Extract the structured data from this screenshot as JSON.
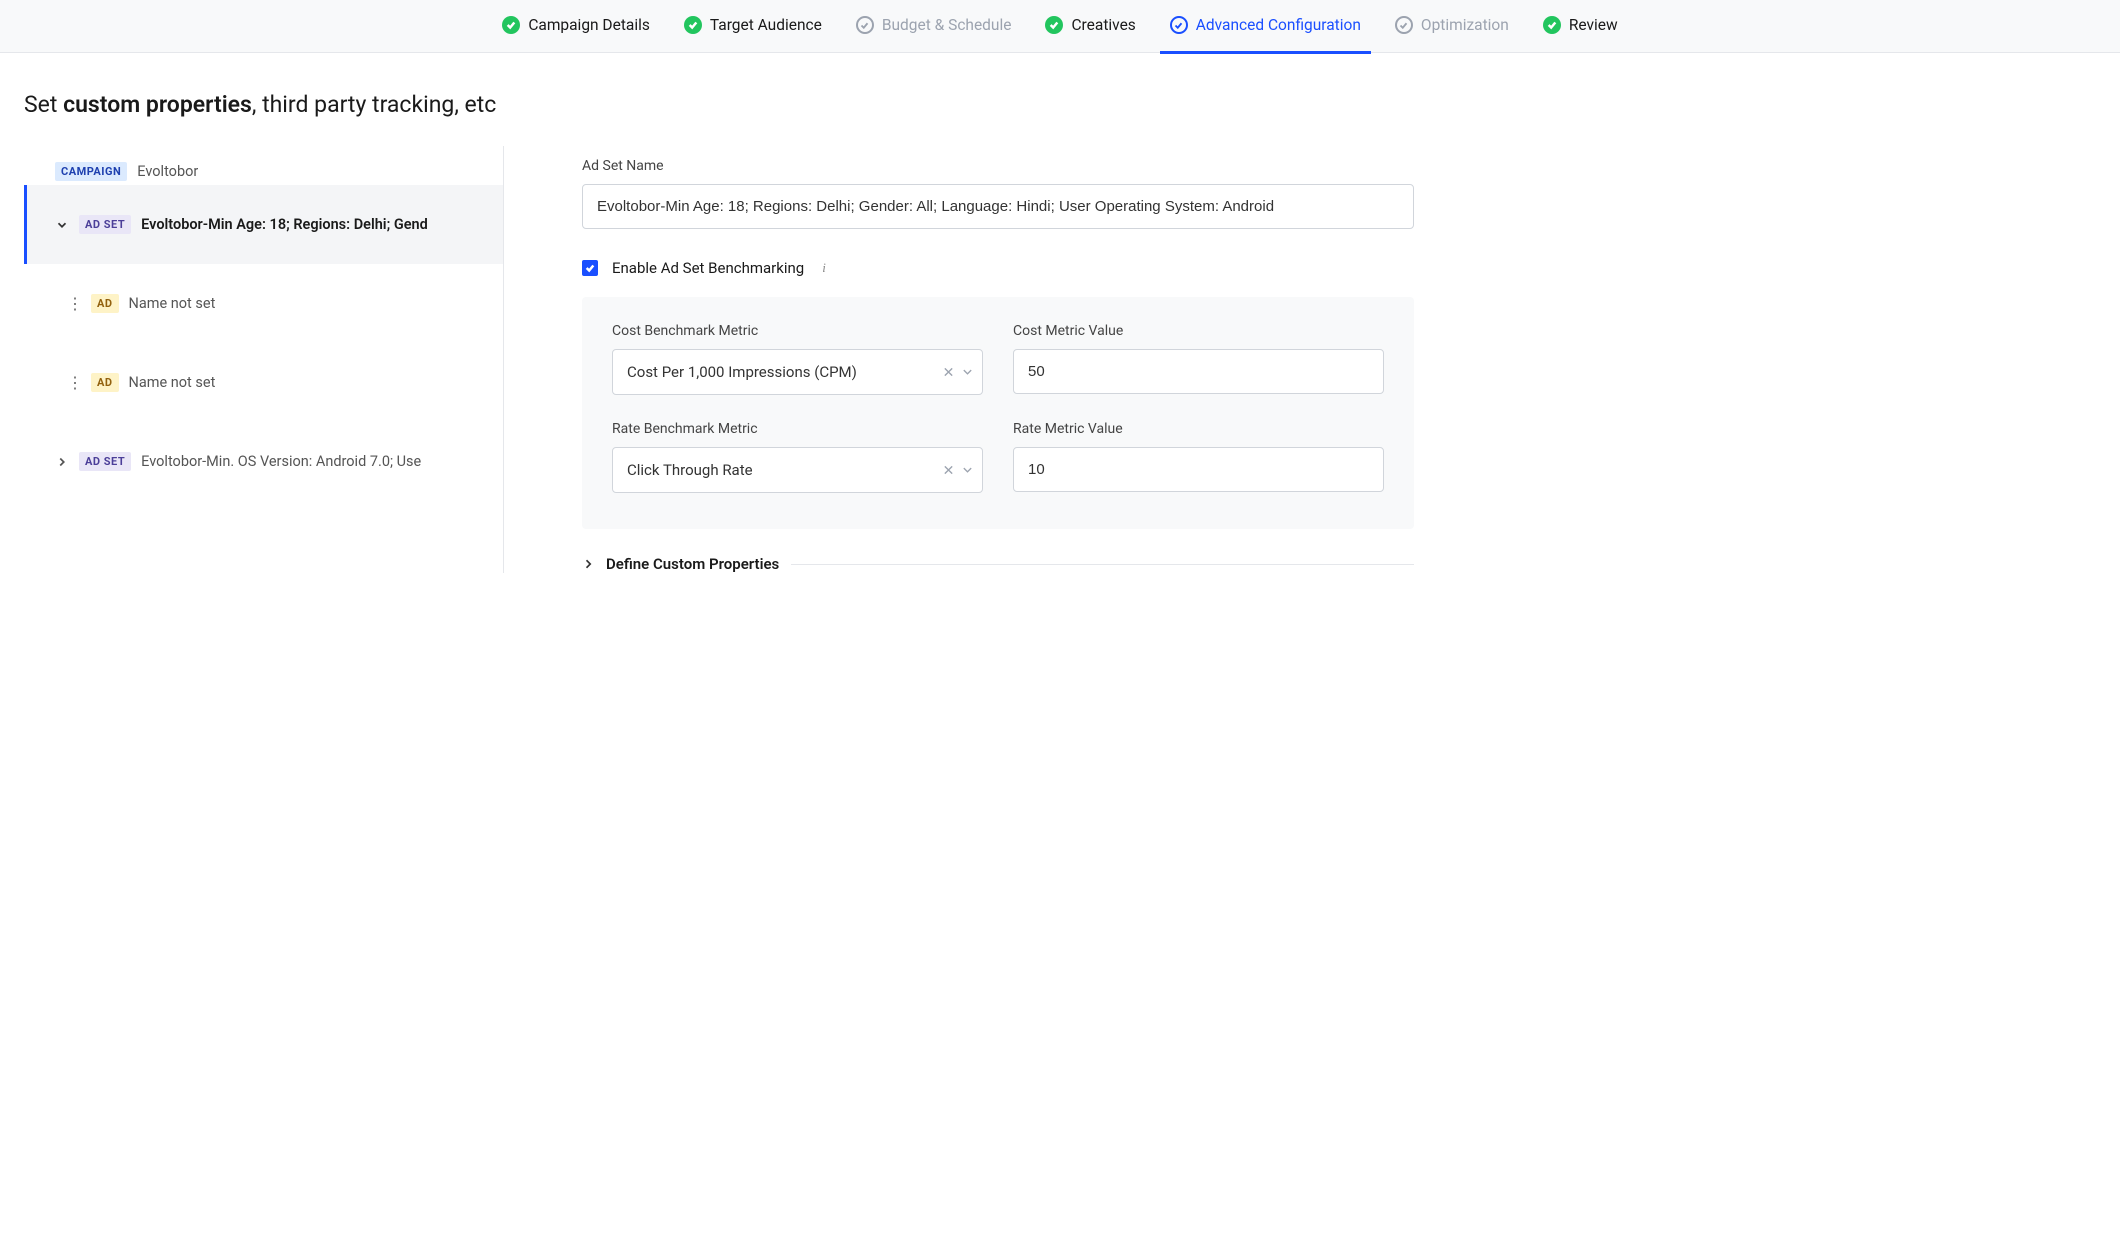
{
  "stepper": [
    {
      "label": "Campaign Details",
      "state": "done"
    },
    {
      "label": "Target Audience",
      "state": "done"
    },
    {
      "label": "Budget & Schedule",
      "state": "disabled"
    },
    {
      "label": "Creatives",
      "state": "done"
    },
    {
      "label": "Advanced Configuration",
      "state": "active"
    },
    {
      "label": "Optimization",
      "state": "disabled"
    },
    {
      "label": "Review",
      "state": "done"
    }
  ],
  "title": {
    "prefix": "Set ",
    "bold": "custom properties",
    "suffix": ", third party tracking, etc"
  },
  "tree": {
    "campaign_badge": "CAMPAIGN",
    "campaign_name": "Evoltobor",
    "adset_badge": "AD SET",
    "ad_badge": "AD",
    "adset1": "Evoltobor-Min Age: 18; Regions: Delhi; Gend",
    "ad1": "Name not set",
    "ad2": "Name not set",
    "adset2": "Evoltobor-Min. OS Version: Android 7.0; Use"
  },
  "form": {
    "adset_name_label": "Ad Set Name",
    "adset_name_value": "Evoltobor-Min Age: 18; Regions: Delhi; Gender: All; Language: Hindi; User Operating System: Android",
    "benchmark_label": "Enable Ad Set Benchmarking",
    "cost_metric_label": "Cost Benchmark Metric",
    "cost_metric_value": "Cost Per 1,000 Impressions (CPM)",
    "cost_value_label": "Cost Metric Value",
    "cost_value": "50",
    "rate_metric_label": "Rate Benchmark Metric",
    "rate_metric_value": "Click Through Rate",
    "rate_value_label": "Rate Metric Value",
    "rate_value": "10",
    "custom_props_label": "Define Custom Properties"
  }
}
